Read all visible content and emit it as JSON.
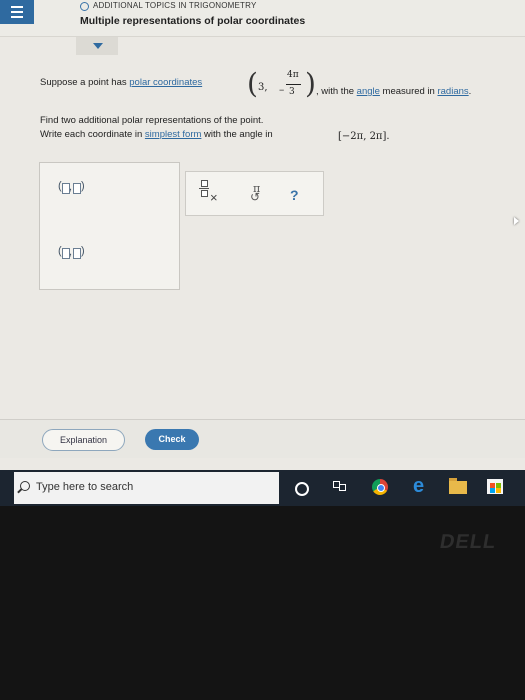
{
  "header": {
    "topic": "ADDITIONAL TOPICS IN TRIGONOMETRY",
    "title": "Multiple representations of polar coordinates"
  },
  "problem": {
    "line1_a": "Suppose a point has ",
    "polar_link": "polar coordinates",
    "coord_r": "3,",
    "coord_minus": "−",
    "coord_num": "4π",
    "coord_den": "3",
    "line1_b": ", with the ",
    "angle_link": "angle",
    "line1_c": " measured in ",
    "radians_link": "radians",
    "line1_d": ".",
    "line2": "Find two additional polar representations of the point.",
    "line3_a": "Write each coordinate in ",
    "simplest_link": "simplest form",
    "line3_b": " with the angle in ",
    "interval": "[−2π, 2π]",
    "line3_c": "."
  },
  "toolbox": {
    "pi_label": "π",
    "clear_label": "×",
    "undo_label": "↺",
    "help_label": "?"
  },
  "footer": {
    "explanation_label": "Explanation",
    "check_label": "Check"
  },
  "taskbar": {
    "search_placeholder": "Type here to search"
  },
  "bezel": {
    "logo": "DELL"
  },
  "colors": {
    "accent": "#2f6aa0",
    "check_button": "#3a78b0",
    "taskbar": "#1c2530"
  }
}
